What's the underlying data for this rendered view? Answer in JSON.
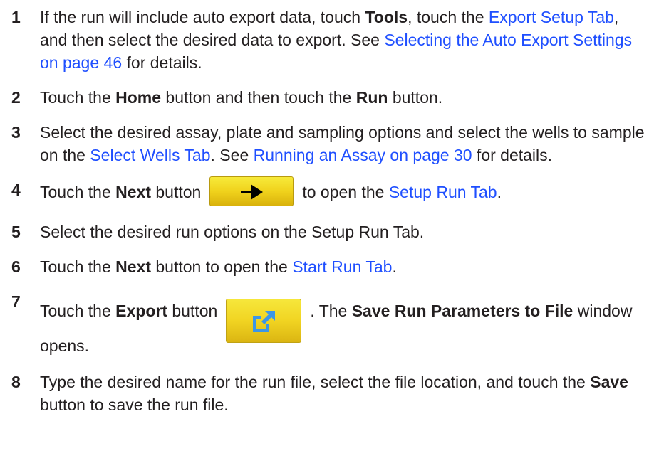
{
  "steps": [
    {
      "num": "1",
      "t1": "If the run will include auto export data, touch ",
      "b1": "Tools",
      "t2": ", touch the ",
      "l1": "Export Setup Tab",
      "t3": ", and then select the desired data to export. See ",
      "l2": "Selecting the Auto Export Settings on page 46",
      "t4": " for details."
    },
    {
      "num": "2",
      "t1": "Touch the ",
      "b1": "Home",
      "t2": " button and then touch the ",
      "b2": "Run",
      "t3": " button."
    },
    {
      "num": "3",
      "t1": "Select the desired assay, plate and sampling options and select the wells to sample on the ",
      "l1": "Select Wells Tab",
      "t2": ". See ",
      "l2": "Running an Assay on page 30",
      "t3": " for details."
    },
    {
      "num": "4",
      "t1": "Touch the ",
      "b1": "Next",
      "t2": " button",
      "icon": "arrow-right-icon",
      "t3": "to open the ",
      "l1": "Setup Run Tab",
      "t4": "."
    },
    {
      "num": "5",
      "t1": "Select the desired run options on the Setup Run Tab."
    },
    {
      "num": "6",
      "t1": "Touch the ",
      "b1": "Next",
      "t2": " button to open the ",
      "l1": "Start Run Tab",
      "t3": "."
    },
    {
      "num": "7",
      "t1": "Touch the ",
      "b1": "Export",
      "t2": " button",
      "icon": "export-icon",
      "t3": ". The ",
      "b2": "Save Run Parameters to File",
      "t4": " window opens."
    },
    {
      "num": "8",
      "t1": "Type the desired name for the run file, select the file location, and touch the ",
      "b1": "Save",
      "t2": " button to save the run file."
    }
  ],
  "colors": {
    "text": "#231f20",
    "link": "#1f4fff",
    "button_yellow": "#f0d21c",
    "export_icon_blue": "#3c96e6"
  }
}
